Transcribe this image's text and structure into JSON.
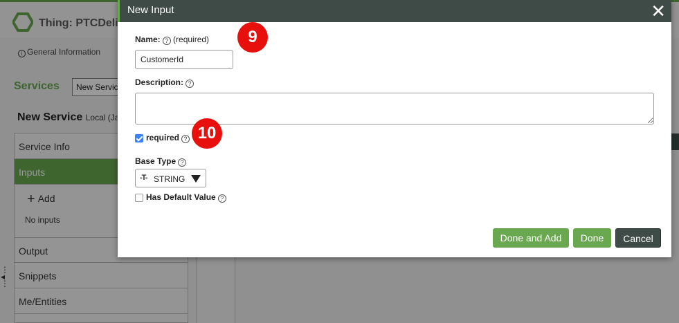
{
  "app": {
    "thing_title": "Thing: PTCDeli",
    "general_info": "General Information",
    "services_label": "Services",
    "new_service_button": "New Servic",
    "new_service_title": "New Service",
    "new_service_sub": "Local (Ja"
  },
  "nav": {
    "items": [
      {
        "label": "Service Info"
      },
      {
        "label": "Inputs"
      },
      {
        "label": "Output"
      },
      {
        "label": "Snippets"
      },
      {
        "label": "Me/Entities"
      }
    ],
    "add_label": "Add",
    "no_inputs": "No inputs"
  },
  "modal": {
    "title": "New Input",
    "close_icon": "close-icon",
    "name_label": "Name:",
    "name_required_hint": "(required)",
    "name_value": "CustomerId",
    "description_label": "Description:",
    "description_value": "",
    "required_label": "required",
    "required_checked": true,
    "base_type_label": "Base Type",
    "base_type_icon": "-T-",
    "base_type_value": "STRING",
    "has_default_label": "Has Default Value",
    "has_default_checked": false,
    "buttons": {
      "done_and_add": "Done and Add",
      "done": "Done",
      "cancel": "Cancel"
    }
  },
  "annotations": {
    "badge_1": "9",
    "badge_2": "10"
  },
  "colors": {
    "accent_green": "#6aa84f",
    "header_dark": "#3f4b47",
    "badge_red": "#e8100d",
    "checkbox_blue": "#3b82f6"
  }
}
